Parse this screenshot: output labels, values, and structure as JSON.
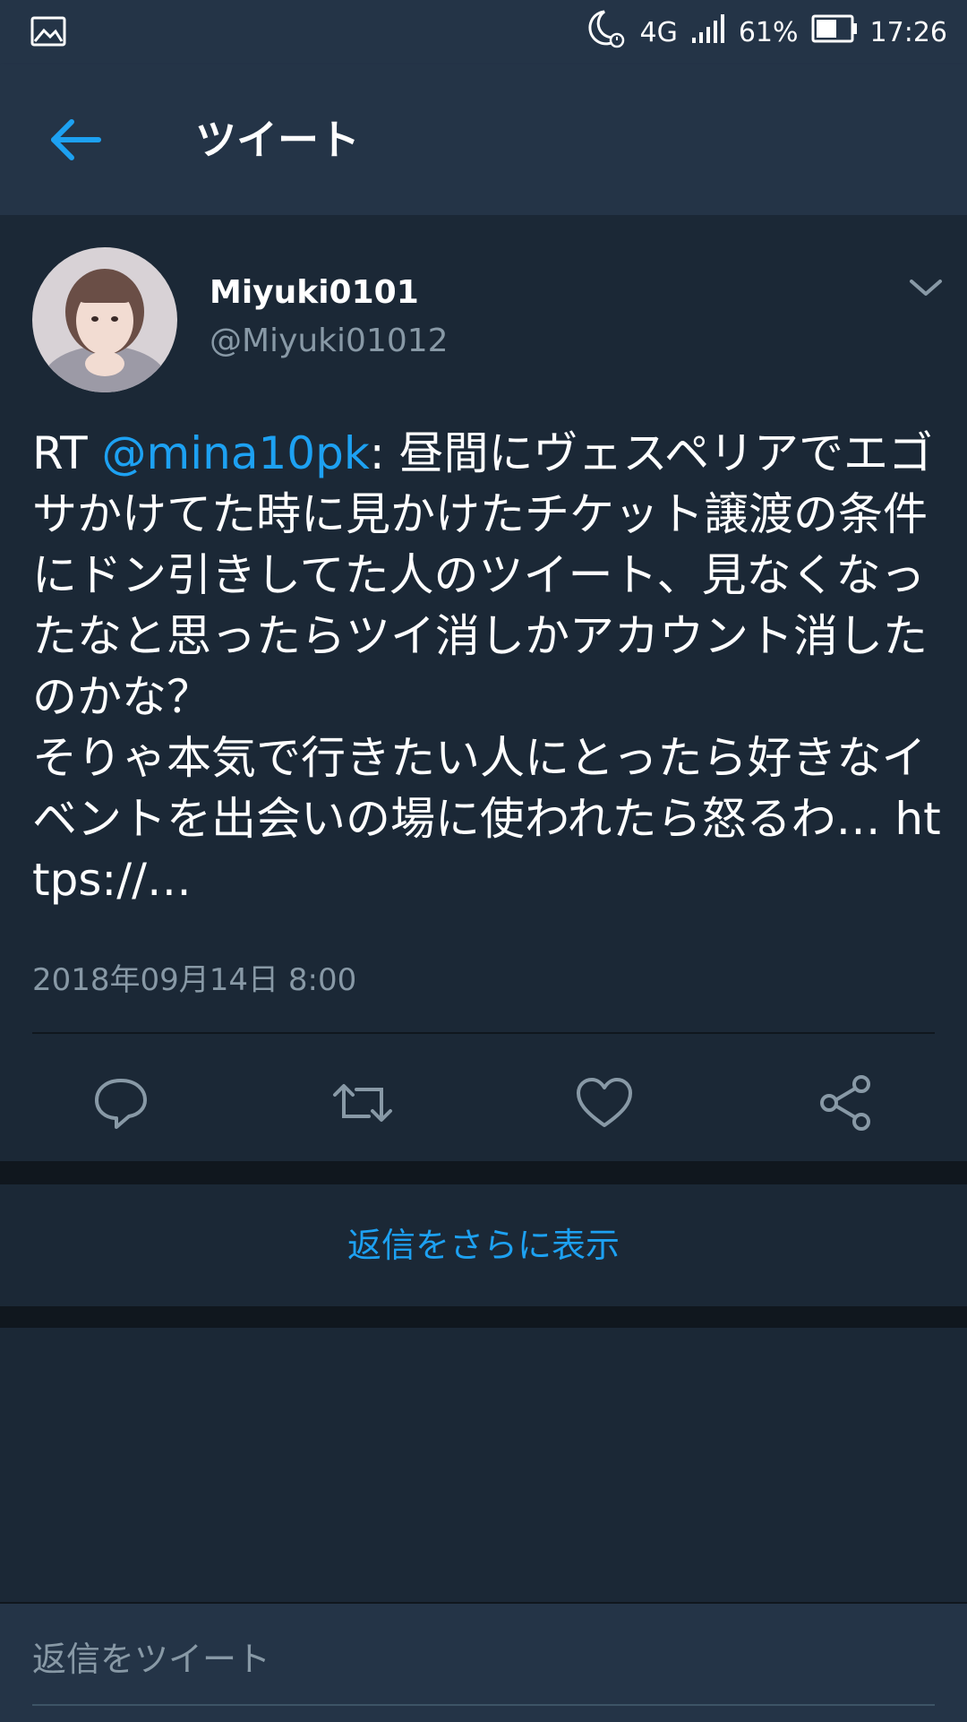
{
  "status_bar": {
    "network": "4G",
    "battery": "61%",
    "time": "17:26",
    "icons": [
      "image-icon",
      "moon-alarm-icon",
      "signal-icon",
      "battery-icon"
    ]
  },
  "app_bar": {
    "title": "ツイート",
    "back_icon": "back-arrow-icon"
  },
  "tweet": {
    "display_name": "Miyuki0101",
    "handle": "@Miyuki01012",
    "rt_prefix": "RT ",
    "mention": "@mina10pk",
    "body": ": 昼間にヴェスペリアでエゴサかけてた時に見かけたチケット譲渡の条件にドン引きしてた人のツイート、見なくなったなと思ったらツイ消しかアカウント消したのかな？\nそりゃ本気で行きたい人にとったら好きなイベントを出会いの場に使われたら怒るわ… https://…",
    "timestamp": "2018年09月14日 8:00",
    "actions": [
      "reply-icon",
      "retweet-icon",
      "like-icon",
      "share-icon"
    ]
  },
  "more_replies": "返信をさらに表示",
  "reply_bar": {
    "placeholder": "返信をツイート"
  },
  "colors": {
    "background": "#1b2836",
    "bar": "#243447",
    "accent": "#1da1f2",
    "secondary_text": "#8899a6"
  }
}
